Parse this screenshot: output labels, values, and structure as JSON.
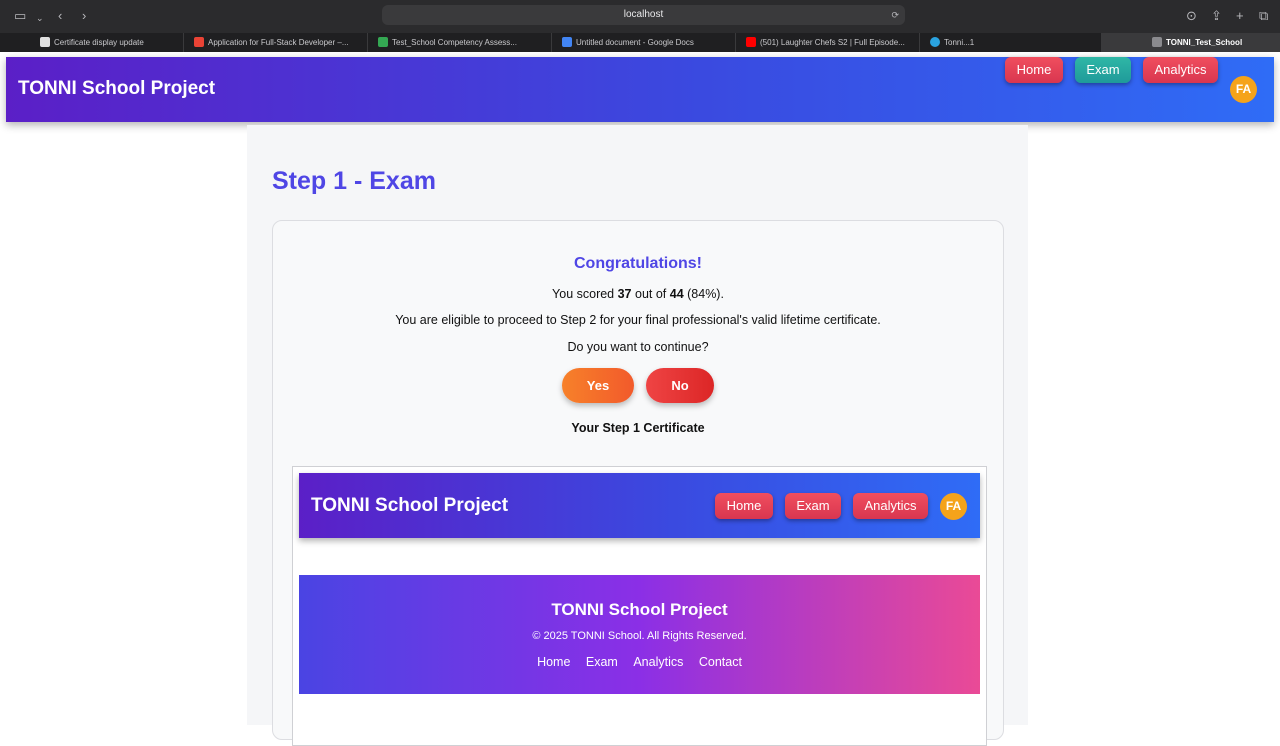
{
  "browser": {
    "address": "localhost",
    "tabs": [
      {
        "label": "Certificate display update",
        "color": "#e0e0e0"
      },
      {
        "label": "Application for Full-Stack Developer –...",
        "color": "#ea4335"
      },
      {
        "label": "Test_School Competency Assess...",
        "color": "#34a853"
      },
      {
        "label": "Untitled document - Google Docs",
        "color": "#4285f4"
      },
      {
        "label": "(501) Laughter Chefs S2 | Full Episode...",
        "color": "#ff0000"
      },
      {
        "label": "Tonni...1",
        "color": "#2aa3e0"
      },
      {
        "label": "TONNI_Test_School",
        "color": "#8a8a8e"
      }
    ]
  },
  "navbar": {
    "brand": "TONNI School Project",
    "home": "Home",
    "exam": "Exam",
    "analytics": "Analytics",
    "avatar": "FA"
  },
  "main": {
    "title": "Step 1 - Exam",
    "congrats": "Congratulations!",
    "score_prefix": "You scored ",
    "score": "37",
    "score_mid": " out of ",
    "total": "44",
    "score_suffix": " (84%).",
    "eligible": "You are eligible to proceed to Step 2 for your final professional's valid lifetime certificate.",
    "question": "Do you want to continue?",
    "yes": "Yes",
    "no": "No",
    "cert_label": "Your Step 1 Certificate"
  },
  "certificate": {
    "brand": "TONNI School Project",
    "home": "Home",
    "exam": "Exam",
    "analytics": "Analytics",
    "avatar": "FA",
    "footer_title": "TONNI School Project",
    "footer_copy": "© 2025 TONNI School. All Rights Reserved.",
    "footer_links": [
      "Home",
      "Exam",
      "Analytics",
      "Contact"
    ]
  },
  "colors": {
    "accent": "#4f46e5",
    "nav_red": "#e83f57",
    "nav_teal": "#27a9a0",
    "avatar": "#f5a31a"
  }
}
